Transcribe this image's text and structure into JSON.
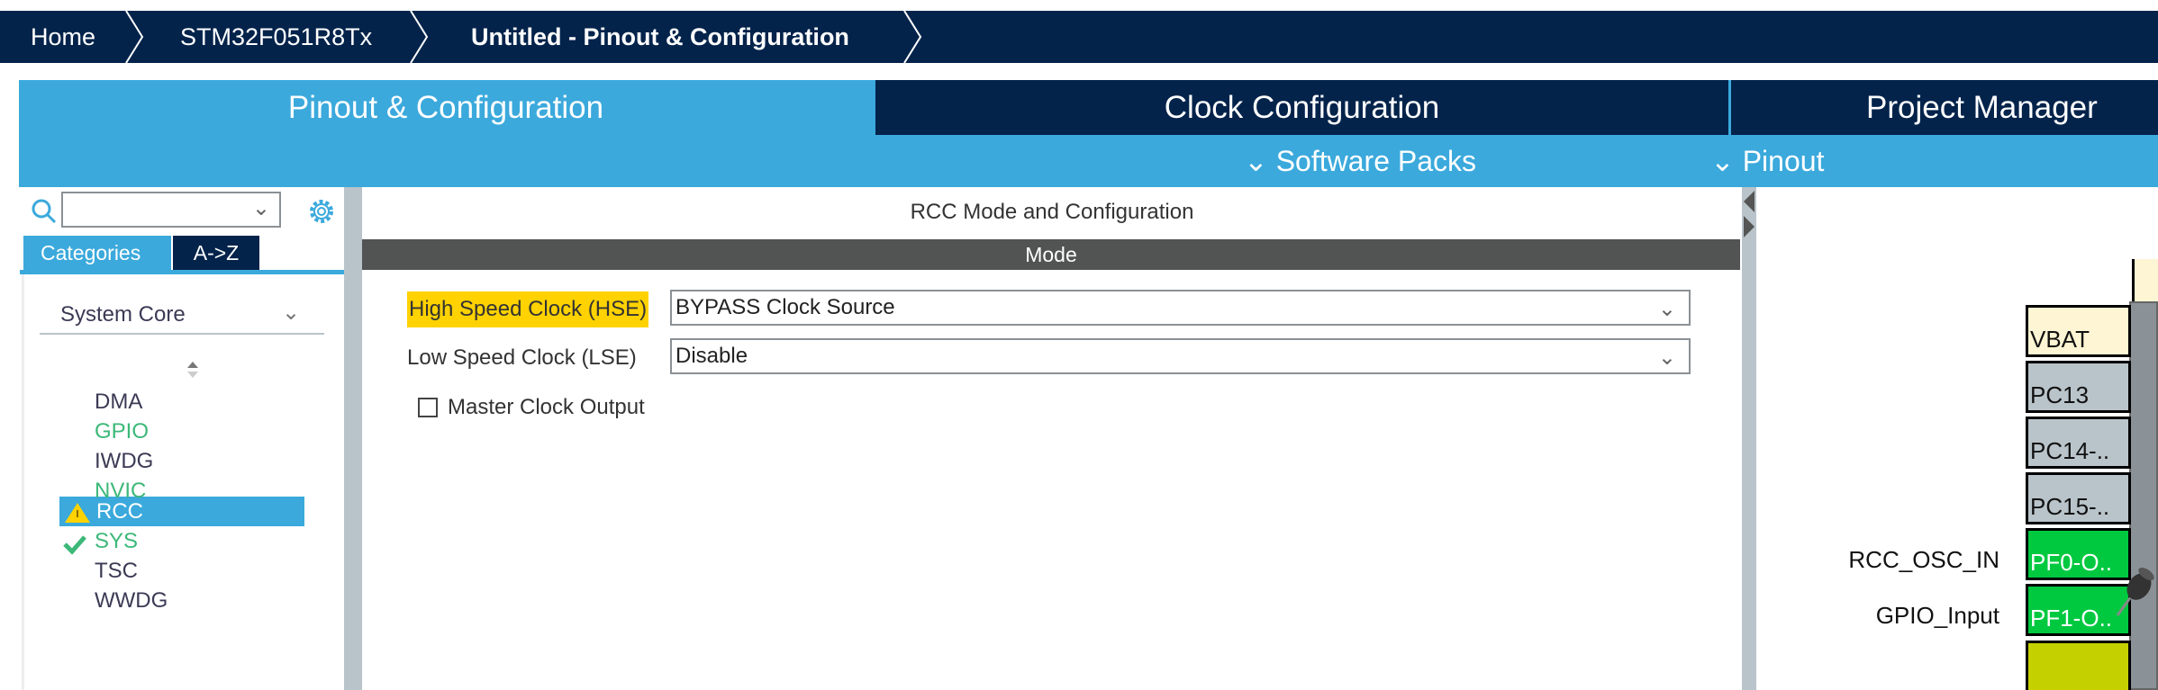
{
  "breadcrumb": [
    "Home",
    "STM32F051R8Tx",
    "Untitled - Pinout & Configuration"
  ],
  "tabs": {
    "pinout": "Pinout & Configuration",
    "clock": "Clock Configuration",
    "project": "Project Manager"
  },
  "subbar": {
    "software_packs": "Software Packs",
    "pinout": "Pinout"
  },
  "left": {
    "search_value": "",
    "tab_categories": "Categories",
    "tab_az": "A->Z",
    "category": "System Core",
    "items": [
      {
        "label": "DMA",
        "status": "none"
      },
      {
        "label": "GPIO",
        "status": "configured"
      },
      {
        "label": "IWDG",
        "status": "none"
      },
      {
        "label": "NVIC",
        "status": "configured"
      },
      {
        "label": "RCC",
        "status": "warning"
      },
      {
        "label": "SYS",
        "status": "ok"
      },
      {
        "label": "TSC",
        "status": "none"
      },
      {
        "label": "WWDG",
        "status": "none"
      }
    ]
  },
  "center": {
    "title": "RCC Mode and Configuration",
    "section": "Mode",
    "hse_label": "High Speed Clock (HSE)",
    "hse_value": "BYPASS Clock Source",
    "lse_label": "Low Speed Clock (LSE)",
    "lse_value": "Disable",
    "mco_label": "Master Clock Output",
    "mco_checked": false
  },
  "pins": [
    {
      "name": "VBAT",
      "signal": "",
      "color": "#fdf5d3"
    },
    {
      "name": "PC13",
      "signal": "",
      "color": "#b9c4ca"
    },
    {
      "name": "PC14-..",
      "signal": "",
      "color": "#b9c4ca"
    },
    {
      "name": "PC15-..",
      "signal": "",
      "color": "#b9c4ca"
    },
    {
      "name": "PF0-O..",
      "signal": "RCC_OSC_IN",
      "color": "#00c940"
    },
    {
      "name": "PF1-O..",
      "signal": "GPIO_Input",
      "color": "#00c940"
    }
  ],
  "colors": {
    "navy": "#03234b",
    "accent": "#3ba9dc",
    "warning": "#ffd200",
    "green": "#3cb878"
  }
}
